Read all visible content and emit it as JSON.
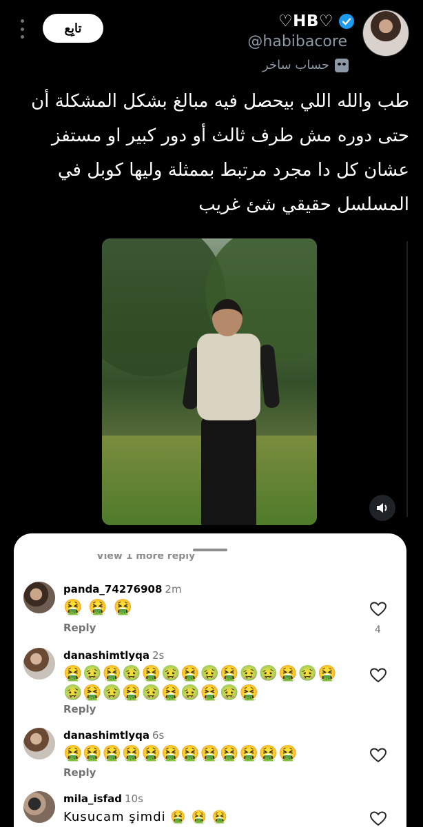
{
  "author": {
    "display_name": "♡HB♡",
    "handle": "@habibacore",
    "parody_label": "حساب ساخر",
    "follow_label": "تابِع"
  },
  "tweet": {
    "text": "طب والله اللي بيحصل فيه مبالغ بشكل المشكلة أن حتى دوره مش طرف ثالث أو دور كبير او مستفز عشان كل دا مجرد مرتبط بممثلة وليها كوبل في المسلسل حقيقي شئ غريب"
  },
  "video": {
    "mute_icon": "speaker-icon"
  },
  "comments_sheet": {
    "view_more": "View 1 more reply",
    "comments": [
      {
        "user": "panda_74276908",
        "time": "2m",
        "body": "🤮 🤮 🤮",
        "reply": "Reply",
        "likes": "4"
      },
      {
        "user": "danashimtlyqa",
        "time": "2s",
        "body": "🤮🤢🤮🤢🤮🤢🤮🤢🤮🤢🤢🤮🤢🤮🤢🤮🤢🤮🤢🤮🤢🤮🤢🤮",
        "reply": "Reply"
      },
      {
        "user": "danashimtlyqa",
        "time": "6s",
        "body": "🤮🤮🤮🤮🤮🤮🤮🤮🤮🤮🤮🤮",
        "reply": "Reply"
      },
      {
        "user": "mila_isfad",
        "time": "10s",
        "body": "Kusucam şimdi 🤮 🤮 🤮"
      }
    ]
  },
  "colors": {
    "verified": "#1d9bf0",
    "background": "#000000",
    "sheet": "#ffffff"
  }
}
